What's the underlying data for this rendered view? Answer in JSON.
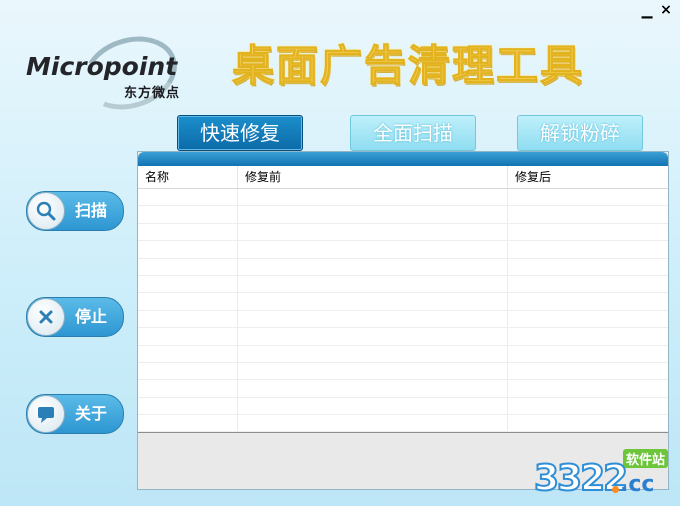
{
  "window": {
    "minimize_icon": "minimize-icon",
    "close_icon": "close-icon",
    "minimize_glyph": "▁",
    "close_glyph": "×"
  },
  "logo": {
    "brand": "Micropoint",
    "subtitle": "东方微点"
  },
  "title": "桌面广告清理工具",
  "tabs": [
    {
      "label": "快速修复",
      "active": true
    },
    {
      "label": "全面扫描",
      "active": false
    },
    {
      "label": "解锁粉碎",
      "active": false
    }
  ],
  "side_buttons": [
    {
      "label": "扫描",
      "icon": "search-icon"
    },
    {
      "label": "停止",
      "icon": "close-icon"
    },
    {
      "label": "关于",
      "icon": "chat-icon"
    }
  ],
  "table": {
    "columns": [
      "名称",
      "修复前",
      "修复后"
    ],
    "rows": []
  },
  "watermark": {
    "site": "软件站",
    "number": "3322",
    "domain": ".cc"
  },
  "colors": {
    "accent": "#1a86c6",
    "title_gold": "#f4cf55",
    "background": "#cdeefa"
  }
}
